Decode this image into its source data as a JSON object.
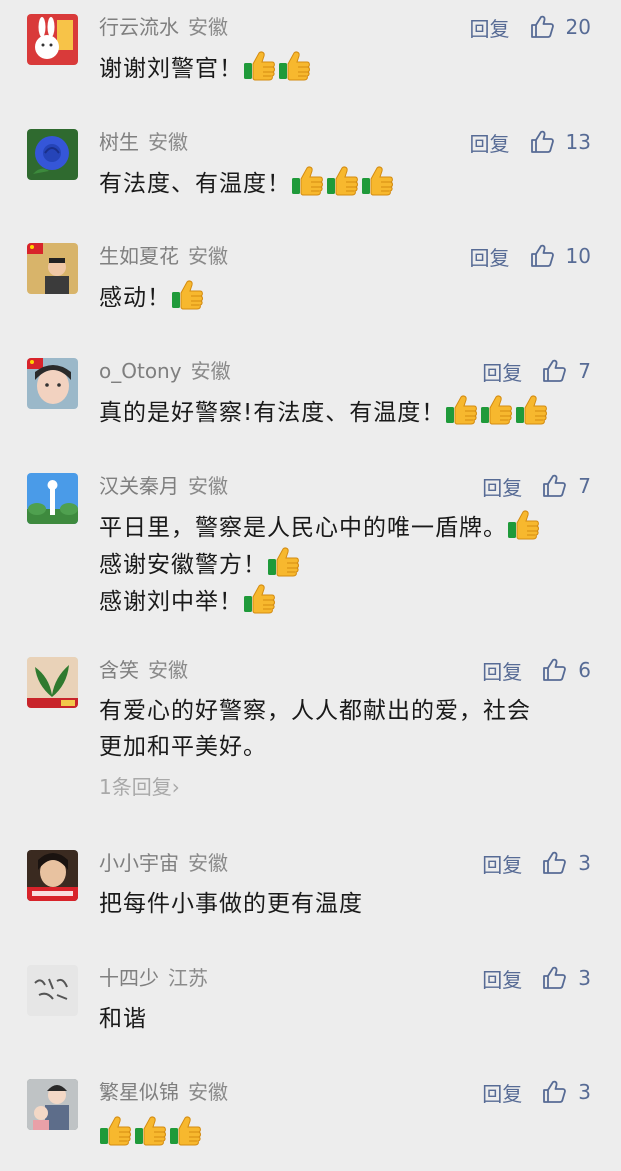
{
  "comments": [
    {
      "nickname": "行云流水",
      "location": "安徽",
      "reply_label": "回复",
      "likes": "20",
      "lines": [
        {
          "text": "谢谢刘警官！",
          "thumbs": 2
        }
      ],
      "avatar": {
        "bg": "#d93a3a",
        "accent": "#ffffff",
        "kind": "rabbit"
      }
    },
    {
      "nickname": "树生",
      "location": "安徽",
      "reply_label": "回复",
      "likes": "13",
      "lines": [
        {
          "text": "有法度、有温度！",
          "thumbs": 3
        }
      ],
      "avatar": {
        "bg": "#2f6a2f",
        "accent": "#3556d8",
        "kind": "rose"
      }
    },
    {
      "nickname": "生如夏花",
      "location": "安徽",
      "reply_label": "回复",
      "likes": "10",
      "lines": [
        {
          "text": "感动！",
          "thumbs": 1
        }
      ],
      "avatar": {
        "bg": "#d8b46a",
        "accent": "#3b3b3b",
        "kind": "person-flag"
      }
    },
    {
      "nickname": "o_Otony",
      "location": "安徽",
      "reply_label": "回复",
      "likes": "7",
      "lines": [
        {
          "text": "真的是好警察!有法度、有温度！",
          "thumbs": 3
        }
      ],
      "avatar": {
        "bg": "#9bb8c9",
        "accent": "#f2d2c0",
        "kind": "face-flag"
      }
    },
    {
      "nickname": "汉关秦月",
      "location": "安徽",
      "reply_label": "回复",
      "likes": "7",
      "lines": [
        {
          "text": "平日里，警察是人民心中的唯一盾牌。",
          "thumbs": 1
        },
        {
          "text": "感谢安徽警方！",
          "thumbs": 1
        },
        {
          "text": "感谢刘中举！",
          "thumbs": 1
        }
      ],
      "avatar": {
        "bg": "#4a9be8",
        "accent": "#ffffff",
        "kind": "tower"
      }
    },
    {
      "nickname": "含笑",
      "location": "安徽",
      "reply_label": "回复",
      "likes": "6",
      "lines": [
        {
          "text": "有爱心的好警察，人人都献出的爱，社会",
          "thumbs": 0
        },
        {
          "text": "更加和平美好。",
          "thumbs": 0
        }
      ],
      "reply_count": "1条回复",
      "avatar": {
        "bg": "#cfe3c8",
        "accent": "#2f7a2f",
        "kind": "plant"
      }
    },
    {
      "nickname": "小小宇宙",
      "location": "安徽",
      "reply_label": "回复",
      "likes": "3",
      "lines": [
        {
          "text": "把每件小事做的更有温度",
          "thumbs": 0
        }
      ],
      "avatar": {
        "bg": "#3a2a20",
        "accent": "#d8232a",
        "kind": "badge-face"
      }
    },
    {
      "nickname": "十四少",
      "location": "江苏",
      "reply_label": "回复",
      "likes": "3",
      "lines": [
        {
          "text": "和谐",
          "thumbs": 0
        }
      ],
      "avatar": {
        "bg": "#e6e6e6",
        "accent": "#555555",
        "kind": "calligraphy"
      }
    },
    {
      "nickname": "繁星似锦",
      "location": "安徽",
      "reply_label": "回复",
      "likes": "3",
      "lines": [
        {
          "text": "",
          "thumbs": 3
        }
      ],
      "avatar": {
        "bg": "#8a8d8f",
        "accent": "#f3d8c6",
        "kind": "two-people"
      }
    }
  ]
}
